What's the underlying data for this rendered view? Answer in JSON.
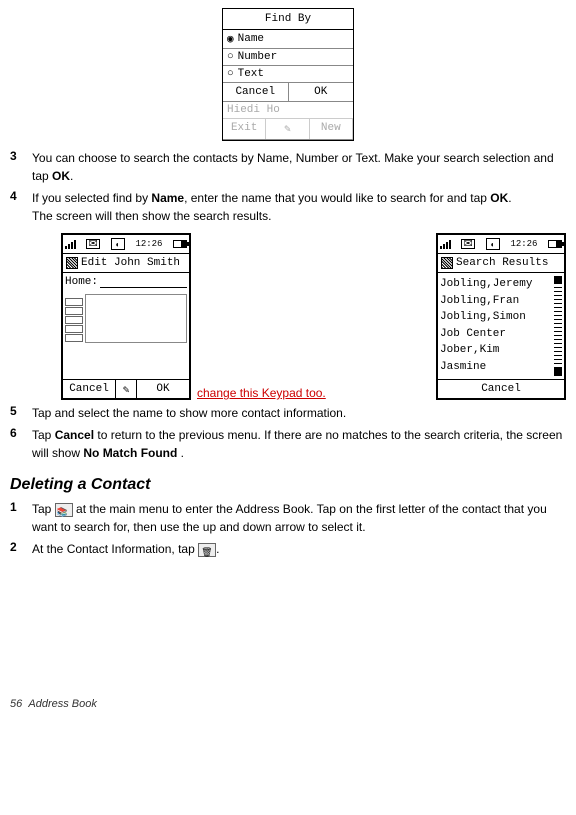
{
  "popup": {
    "title": "Find By",
    "options": [
      "Name",
      "Number",
      "Text"
    ],
    "cancel": "Cancel",
    "ok": "OK",
    "gray_row": "Hiedi Ho",
    "gray_exit": "Exit",
    "gray_new": "New"
  },
  "steps_a": {
    "s3": {
      "num": "3",
      "pre": "You can choose to search the contacts by Name, Number or Text. Make your search selection and tap ",
      "ok": "OK",
      "post": "."
    },
    "s4": {
      "num": "4",
      "pre": "If you selected find by ",
      "name_bold": "Name",
      "mid": ", enter the name that you would like to search for and tap ",
      "ok": "OK",
      "post2": ".",
      "line2": "The screen will then show the search results."
    }
  },
  "status": {
    "time": "12:26"
  },
  "editscreen": {
    "title": "Edit John Smith",
    "home_label": "Home:",
    "cancel": "Cancel",
    "ok": "OK"
  },
  "marker": "change this Keypad too.",
  "results": {
    "title": "Search Results",
    "items": [
      "Jobling,Jeremy",
      "Jobling,Fran",
      "Jobling,Simon",
      "Job Center",
      "Jober,Kim",
      "Jasmine"
    ],
    "cancel": "Cancel"
  },
  "steps_b": {
    "s5": {
      "num": "5",
      "text": "Tap and select the name to show more contact information."
    },
    "s6": {
      "num": "6",
      "pre": "Tap ",
      "cancel_bold": "Cancel",
      "mid": " to return to the previous menu. If there are no matches to the search criteria, the screen will show ",
      "nmf": "No Match Found",
      "post": " ."
    }
  },
  "section": "Deleting a Contact",
  "steps_c": {
    "s1": {
      "num": "1",
      "pre": "Tap ",
      "post": " at the main menu to enter the Address Book. Tap on the first letter of the contact that you want to search for, then use the up and down arrow to select it."
    },
    "s2": {
      "num": "2",
      "pre": "At the Contact Information, tap ",
      "post": "."
    }
  },
  "footer": {
    "page": "56",
    "title": "Address Book"
  }
}
